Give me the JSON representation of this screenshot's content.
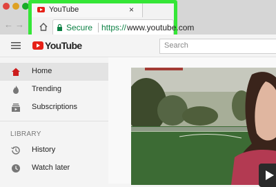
{
  "browser": {
    "tab": {
      "title": "YouTube",
      "close_glyph": "×"
    },
    "nav": {
      "back_glyph": "←",
      "forward_glyph": "→"
    },
    "address_bar": {
      "secure_label": "Secure",
      "scheme": "https://",
      "url": "www.youtube.com"
    },
    "highlight_color": "#35e637"
  },
  "youtube": {
    "logo_text": "YouTube",
    "search": {
      "placeholder": "Search"
    },
    "sidebar": {
      "items": [
        {
          "label": "Home",
          "icon": "home-icon",
          "active": true
        },
        {
          "label": "Trending",
          "icon": "flame-icon",
          "active": false
        },
        {
          "label": "Subscriptions",
          "icon": "subscriptions-icon",
          "active": false
        }
      ],
      "library_heading": "LIBRARY",
      "library_items": [
        {
          "label": "History",
          "icon": "history-icon"
        },
        {
          "label": "Watch later",
          "icon": "clock-icon"
        }
      ]
    },
    "brand_color": "#e62117"
  }
}
